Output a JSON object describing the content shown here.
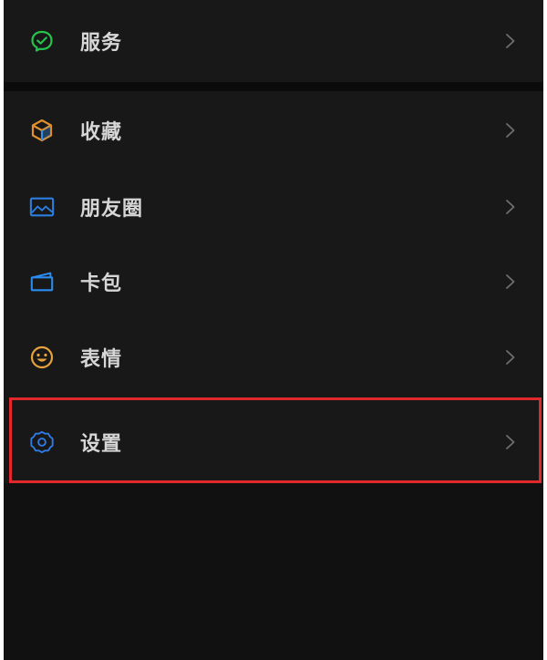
{
  "menu": {
    "top_group": [
      {
        "key": "services",
        "label": "服务",
        "icon": "wechat-pay-icon",
        "color": "#27c24c"
      }
    ],
    "main_group": [
      {
        "key": "favorites",
        "label": "收藏",
        "icon": "cube-icon",
        "color": "#e0912c"
      },
      {
        "key": "moments",
        "label": "朋友圈",
        "icon": "image-icon",
        "color": "#2b7fe0"
      },
      {
        "key": "cards",
        "label": "卡包",
        "icon": "wallet-icon",
        "color": "#2b8cf0"
      },
      {
        "key": "stickers",
        "label": "表情",
        "icon": "smiley-icon",
        "color": "#e6a23c"
      },
      {
        "key": "settings",
        "label": "设置",
        "icon": "gear-icon",
        "color": "#2f7ce6"
      }
    ]
  },
  "highlight": {
    "target": "settings",
    "color": "#e0282d"
  },
  "theme": {
    "background": "#181818",
    "text": "#d6d6d6",
    "chevron": "#6e6e6e"
  }
}
